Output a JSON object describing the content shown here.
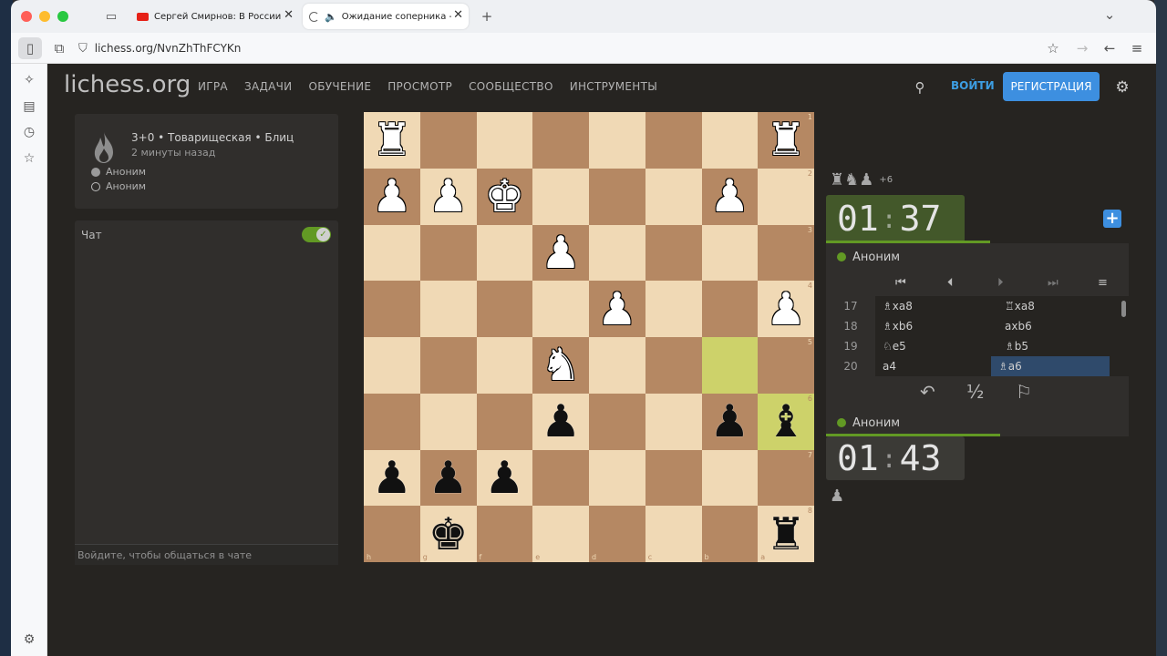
{
  "browser": {
    "tabs": [
      {
        "title": "Сергей Смирнов: В России бо",
        "icon": "youtube-icon",
        "close": "✕"
      },
      {
        "title": "Ожидание соперника - Игр",
        "icon": "loading-icon",
        "audio_icon": "speaker-icon",
        "close": "✕"
      }
    ],
    "new_tab": "+",
    "dropdown": "⌄",
    "url": "lichess.org/NvnZhThFCYKn"
  },
  "site": {
    "logo": "lichess.org",
    "nav": [
      "ИГРА",
      "ЗАДАЧИ",
      "ОБУЧЕНИЕ",
      "ПРОСМОТР",
      "СООБЩЕСТВО",
      "ИНСТРУМЕНТЫ"
    ],
    "login": "ВОЙТИ",
    "register": "РЕГИСТРАЦИЯ"
  },
  "game": {
    "title": "3+0 • Товарищеская • Блиц",
    "time_ago": "2 минуты назад",
    "players": [
      "Аноним",
      "Аноним"
    ]
  },
  "chat": {
    "title": "Чат",
    "placeholder": "Войдите, чтобы общаться в чате",
    "enabled": true
  },
  "board": {
    "ranks": [
      "1",
      "2",
      "3",
      "4",
      "5",
      "6",
      "7",
      "8"
    ],
    "files": [
      "h",
      "g",
      "f",
      "e",
      "d",
      "c",
      "b",
      "a"
    ],
    "light_color": "#f0d9b5",
    "dark_color": "#b58863",
    "highlight_color": "#cdd26a",
    "highlight_dark_color": "#aaa23a",
    "highlights": [
      [
        4,
        6
      ],
      [
        5,
        7
      ]
    ],
    "pieces": [
      {
        "r": 0,
        "c": 0,
        "g": "♜",
        "side": "w"
      },
      {
        "r": 0,
        "c": 7,
        "g": "♜",
        "side": "w"
      },
      {
        "r": 1,
        "c": 0,
        "g": "♟",
        "side": "w"
      },
      {
        "r": 1,
        "c": 1,
        "g": "♟",
        "side": "w"
      },
      {
        "r": 1,
        "c": 2,
        "g": "♚",
        "side": "w"
      },
      {
        "r": 1,
        "c": 6,
        "g": "♟",
        "side": "w"
      },
      {
        "r": 2,
        "c": 3,
        "g": "♟",
        "side": "w"
      },
      {
        "r": 3,
        "c": 4,
        "g": "♟",
        "side": "w"
      },
      {
        "r": 3,
        "c": 7,
        "g": "♟",
        "side": "w"
      },
      {
        "r": 4,
        "c": 3,
        "g": "♞",
        "side": "w"
      },
      {
        "r": 5,
        "c": 3,
        "g": "♟",
        "side": "b"
      },
      {
        "r": 5,
        "c": 6,
        "g": "♟",
        "side": "b"
      },
      {
        "r": 5,
        "c": 7,
        "g": "♝",
        "side": "b"
      },
      {
        "r": 6,
        "c": 0,
        "g": "♟",
        "side": "b"
      },
      {
        "r": 6,
        "c": 1,
        "g": "♟",
        "side": "b"
      },
      {
        "r": 6,
        "c": 2,
        "g": "♟",
        "side": "b"
      },
      {
        "r": 7,
        "c": 1,
        "g": "♚",
        "side": "b"
      },
      {
        "r": 7,
        "c": 7,
        "g": "♜",
        "side": "b"
      }
    ]
  },
  "clocks": {
    "top": {
      "min": "01",
      "sep": ":",
      "sec": "37"
    },
    "bottom": {
      "min": "01",
      "sep": ":",
      "sec": "43"
    }
  },
  "material": {
    "top": "♜♞♟",
    "top_diff": "+6",
    "bottom": "♟"
  },
  "players": {
    "top": "Аноним",
    "bottom": "Аноним"
  },
  "controls": [
    "⏮",
    "⏴",
    "⏵",
    "⏭",
    "≡"
  ],
  "moves": [
    {
      "n": "17",
      "w": "♗xa8",
      "b": "♖xa8"
    },
    {
      "n": "18",
      "w": "♗xb6",
      "b": "axb6"
    },
    {
      "n": "19",
      "w": "♘e5",
      "b": "♗b5"
    },
    {
      "n": "20",
      "w": "a4",
      "b": "♗a6"
    }
  ],
  "actions": {
    "takeback": "↶",
    "draw": "½",
    "resign": "⚐"
  }
}
